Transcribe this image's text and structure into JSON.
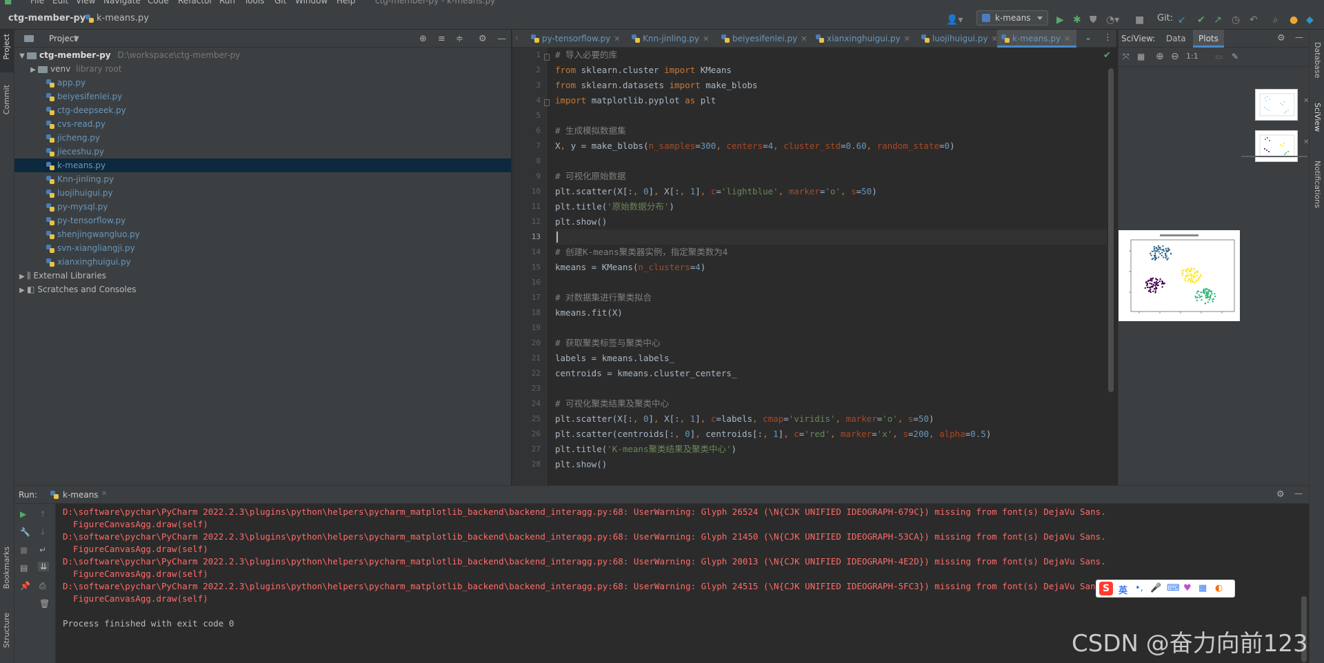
{
  "menu": {
    "items": [
      "File",
      "Edit",
      "View",
      "Navigate",
      "Code",
      "Refactor",
      "Run",
      "Tools",
      "Git",
      "Window",
      "Help"
    ],
    "window_title": "ctg-member-py - k-means.py"
  },
  "nav": {
    "project": "ctg-member-py",
    "file": "k-means.py",
    "run_config": "k-means",
    "git_label": "Git:"
  },
  "project_panel": {
    "title": "Project",
    "root": {
      "name": "ctg-member-py",
      "path": "D:\\workspace\\ctg-member-py"
    },
    "venv": {
      "name": "venv",
      "note": "library root"
    },
    "files": [
      "app.py",
      "beiyesifenlei.py",
      "ctg-deepseek.py",
      "cvs-read.py",
      "jicheng.py",
      "jieceshu.py",
      "k-means.py",
      "Knn-jinling.py",
      "luojihuigui.py",
      "py-mysql.py",
      "py-tensorflow.py",
      "shenjingwangluo.py",
      "svn-xiangliangji.py",
      "xianxinghuigui.py"
    ],
    "selected_file": "k-means.py",
    "external": "External Libraries",
    "scratches": "Scratches and Consoles"
  },
  "tabs": [
    {
      "label": "py-tensorflow.py",
      "active": false
    },
    {
      "label": "Knn-jinling.py",
      "active": false
    },
    {
      "label": "beiyesifenlei.py",
      "active": false
    },
    {
      "label": "xianxinghuigui.py",
      "active": false
    },
    {
      "label": "luojihuigui.py",
      "active": false
    },
    {
      "label": "k-means.py",
      "active": true
    }
  ],
  "code": {
    "line_numbers": [
      "1",
      "2",
      "3",
      "4",
      "5",
      "6",
      "7",
      "8",
      "9",
      "10",
      "11",
      "12",
      "13",
      "14",
      "15",
      "16",
      "17",
      "18",
      "19",
      "20",
      "21",
      "22",
      "23",
      "24",
      "25",
      "26",
      "27",
      "28"
    ],
    "current_line": 13
  },
  "sciview": {
    "title": "SciView:",
    "tab_data": "Data",
    "tab_plots": "Plots",
    "zoom_label": "1:1"
  },
  "left_strip": {
    "project": "Project",
    "commit": "Commit",
    "bookmarks": "Bookmarks",
    "structure": "Structure"
  },
  "right_strip": {
    "database": "Database",
    "sciview": "SciView",
    "notifications": "Notifications"
  },
  "run_panel": {
    "label": "Run:",
    "tab": "k-means",
    "output": [
      {
        "text": "D:\\software\\pychar\\PyCharm 2022.2.3\\plugins\\python\\helpers\\pycharm_matplotlib_backend\\backend_interagg.py:68: UserWarning: Glyph 26524 (\\N{CJK UNIFIED IDEOGRAPH-679C}) missing from font(s) DejaVu Sans.",
        "kind": "err"
      },
      {
        "text": "  FigureCanvasAgg.draw(self)",
        "kind": "err"
      },
      {
        "text": "D:\\software\\pychar\\PyCharm 2022.2.3\\plugins\\python\\helpers\\pycharm_matplotlib_backend\\backend_interagg.py:68: UserWarning: Glyph 21450 (\\N{CJK UNIFIED IDEOGRAPH-53CA}) missing from font(s) DejaVu Sans.",
        "kind": "err"
      },
      {
        "text": "  FigureCanvasAgg.draw(self)",
        "kind": "err"
      },
      {
        "text": "D:\\software\\pychar\\PyCharm 2022.2.3\\plugins\\python\\helpers\\pycharm_matplotlib_backend\\backend_interagg.py:68: UserWarning: Glyph 20013 (\\N{CJK UNIFIED IDEOGRAPH-4E2D}) missing from font(s) DejaVu Sans.",
        "kind": "err"
      },
      {
        "text": "  FigureCanvasAgg.draw(self)",
        "kind": "err"
      },
      {
        "text": "D:\\software\\pychar\\PyCharm 2022.2.3\\plugins\\python\\helpers\\pycharm_matplotlib_backend\\backend_interagg.py:68: UserWarning: Glyph 24515 (\\N{CJK UNIFIED IDEOGRAPH-5FC3}) missing from font(s) DejaVu Sans.",
        "kind": "err"
      },
      {
        "text": "  FigureCanvasAgg.draw(self)",
        "kind": "err"
      },
      {
        "text": "",
        "kind": "ok"
      },
      {
        "text": "Process finished with exit code 0",
        "kind": "ok"
      }
    ]
  },
  "ime": {
    "lang": "英"
  },
  "watermark": "CSDN @奋力向前123",
  "colors": {
    "accent": "#4a88c7",
    "error_text": "#ff6b68",
    "keyword": "#cc7832",
    "string": "#6a8759",
    "comment": "#808080",
    "param": "#aa4926",
    "number": "#6897bb"
  }
}
